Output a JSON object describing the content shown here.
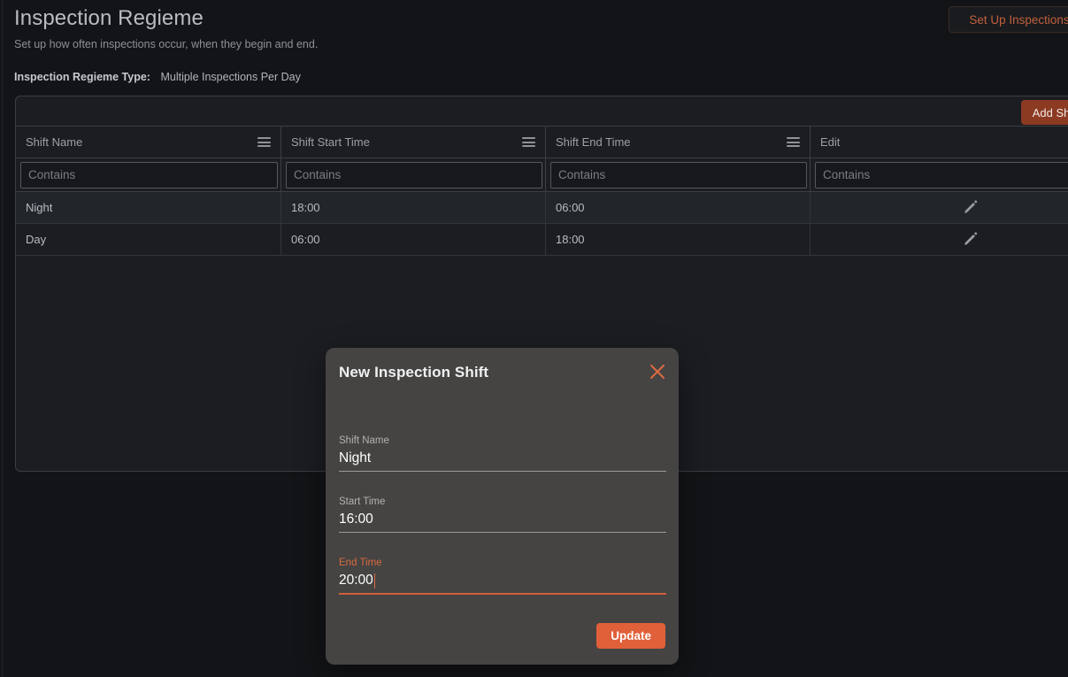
{
  "page": {
    "title": "Inspection Regieme",
    "subtitle": "Set up how often inspections occur, when they begin and end.",
    "regieme_type_label": "Inspection Regieme Type:",
    "regieme_type_value": "Multiple Inspections Per Day",
    "setup_button": "Set Up Inspections"
  },
  "grid": {
    "add_shift_button": "Add Shift",
    "add_shift_plus": "+",
    "columns": [
      {
        "header": "Shift Name",
        "filter_placeholder": "Contains",
        "menu_icon": "hamburger-icon"
      },
      {
        "header": "Shift Start Time",
        "filter_placeholder": "Contains",
        "menu_icon": "hamburger-icon"
      },
      {
        "header": "Shift End Time",
        "filter_placeholder": "Contains",
        "menu_icon": "hamburger-icon"
      },
      {
        "header": "Edit",
        "filter_placeholder": "Contains",
        "menu_icon": "hamburger-icon"
      }
    ],
    "rows": [
      {
        "shift_name": "Night",
        "start_time": "18:00",
        "end_time": "06:00",
        "edit_icon": "pencil-icon"
      },
      {
        "shift_name": "Day",
        "start_time": "06:00",
        "end_time": "18:00",
        "edit_icon": "pencil-icon"
      }
    ]
  },
  "modal": {
    "title": "New Inspection Shift",
    "close_icon": "close-x-icon",
    "fields": [
      {
        "label": "Shift Name",
        "value": "Night",
        "focused": false
      },
      {
        "label": "Start Time",
        "value": "16:00",
        "focused": false
      },
      {
        "label": "End Time",
        "value": "20:00",
        "focused": true
      }
    ],
    "update_button": "Update"
  },
  "colors": {
    "accent": "#e0603a",
    "accent_muted": "#c2603c",
    "add_shift_bg": "#8c3a22",
    "page_bg": "#131417",
    "grid_bg": "#1b1d21",
    "modal_bg": "#454443"
  }
}
